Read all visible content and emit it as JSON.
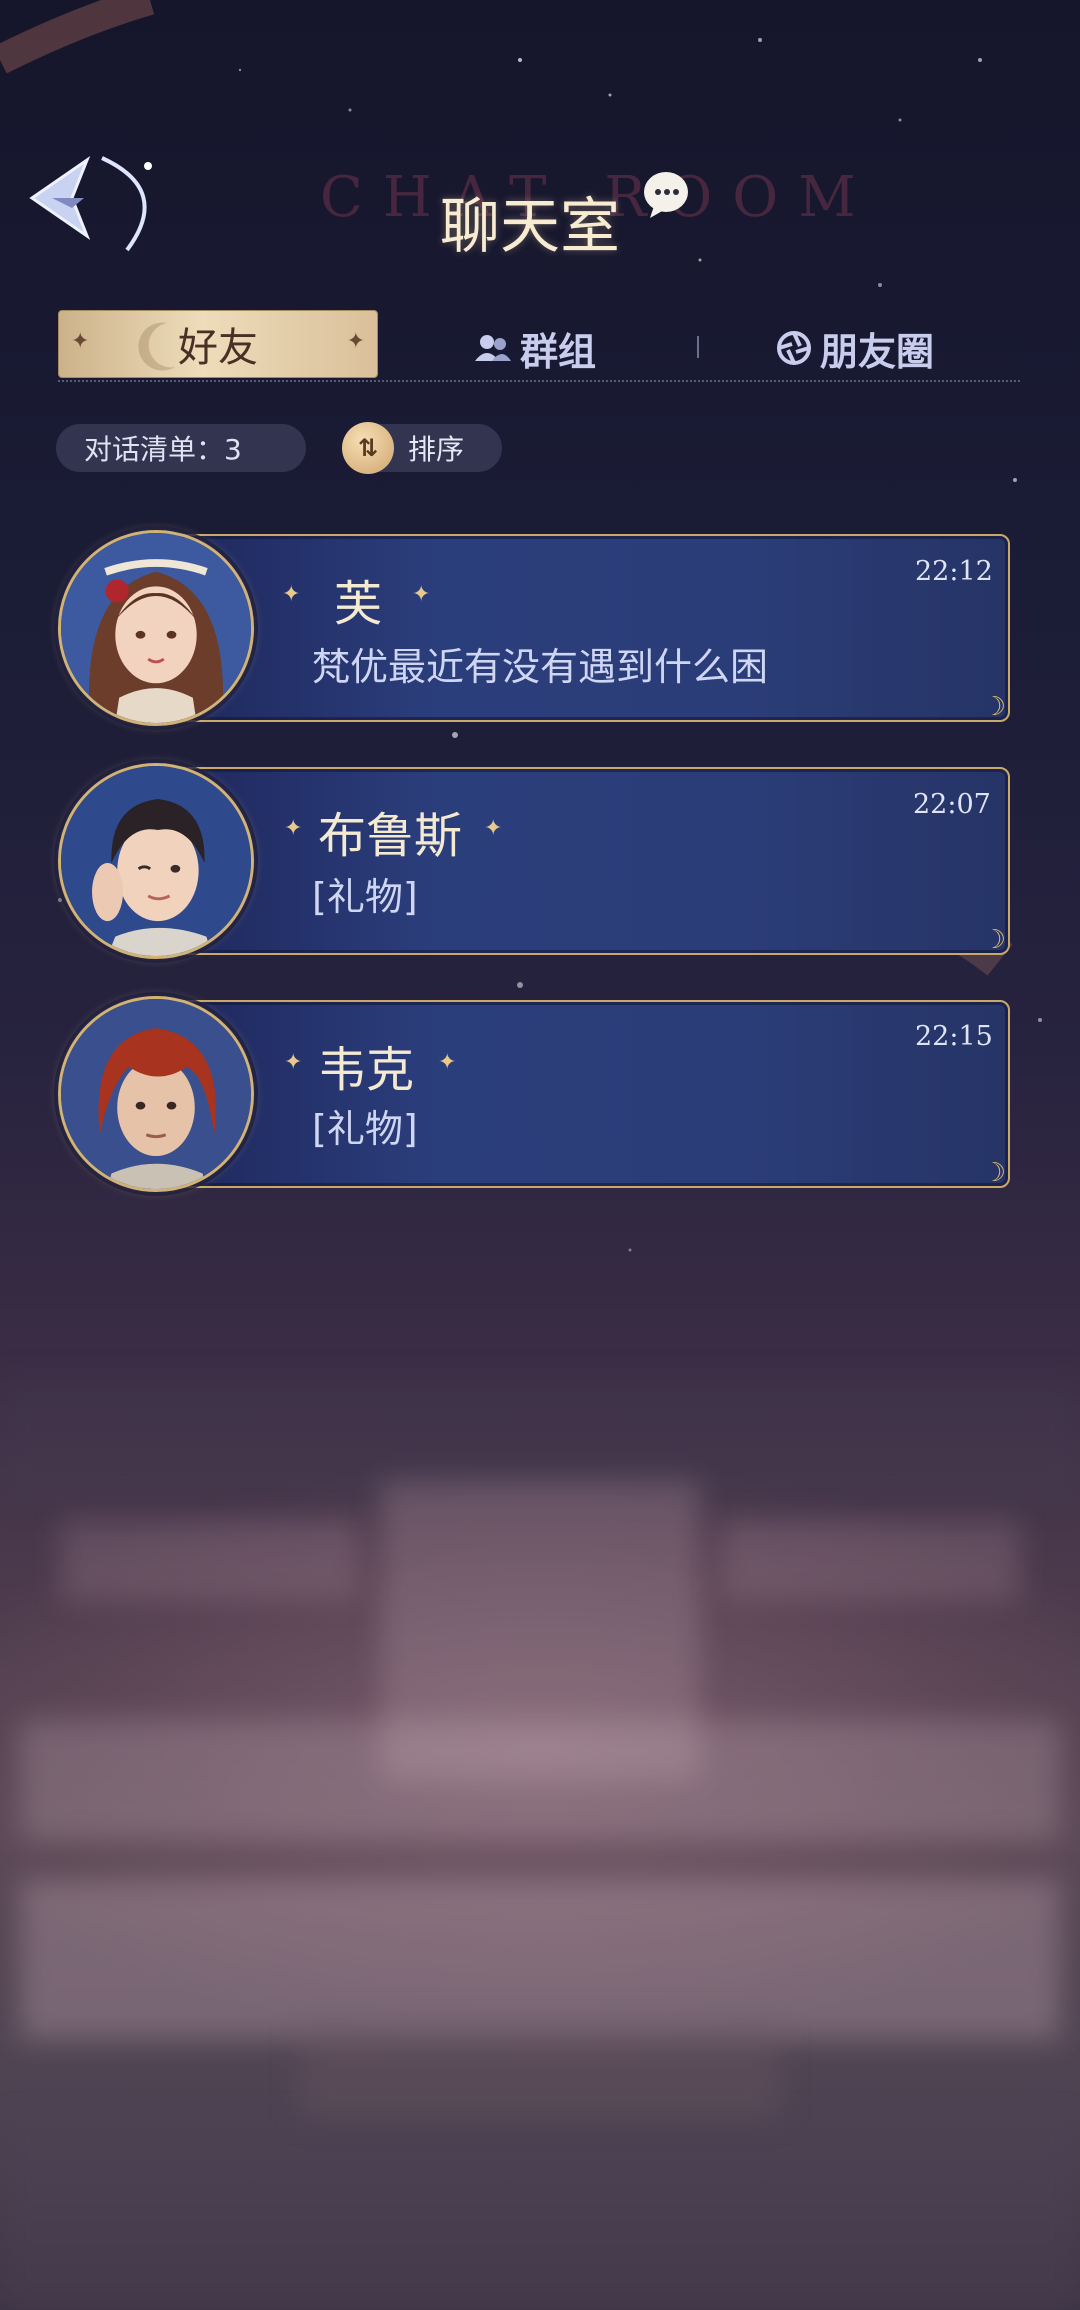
{
  "header": {
    "title": "聊天室",
    "title_ghost": "CHAT ROOM"
  },
  "tabs": [
    {
      "label": "好友",
      "active": true
    },
    {
      "label": "群组",
      "active": false
    },
    {
      "label": "朋友圈",
      "active": false
    }
  ],
  "toolbar": {
    "count_label": "对话清单：3",
    "sort_label": "排序",
    "sort_icon_text": "⇅"
  },
  "chats": [
    {
      "name": "芙",
      "message": "梵优最近有没有遇到什么困",
      "time": "22:12"
    },
    {
      "name": "布鲁斯",
      "message": "[礼物]",
      "time": "22:07"
    },
    {
      "name": "韦克",
      "message": "[礼物]",
      "time": "22:15"
    }
  ],
  "colors": {
    "gold": "#c9a968",
    "card_blue": "#2b3e7c",
    "tab_active": "#eedcba"
  }
}
